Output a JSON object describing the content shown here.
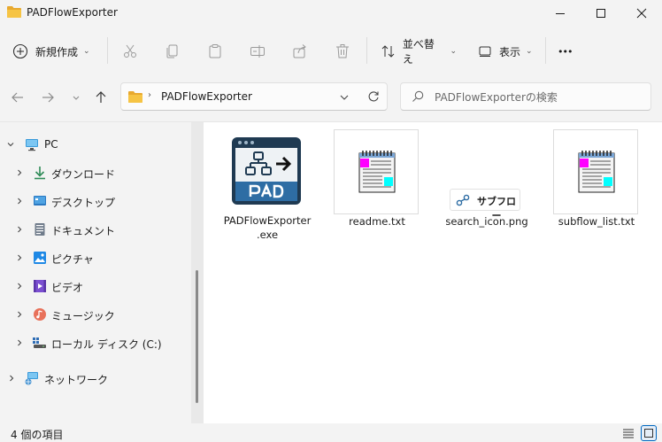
{
  "window": {
    "title": "PADFlowExporter",
    "controls": [
      "minimize",
      "maximize",
      "close"
    ]
  },
  "commandbar": {
    "new_label": "新規作成",
    "sort_label": "並べ替え",
    "view_label": "表示",
    "more_label": "•••"
  },
  "address": {
    "path": "PADFlowExporter"
  },
  "search": {
    "placeholder": "PADFlowExporterの検索"
  },
  "sidebar": {
    "items": [
      {
        "label": "PC",
        "icon": "pc-icon"
      },
      {
        "label": "ダウンロード",
        "icon": "download-icon"
      },
      {
        "label": "デスクトップ",
        "icon": "desktop-icon"
      },
      {
        "label": "ドキュメント",
        "icon": "documents-icon"
      },
      {
        "label": "ピクチャ",
        "icon": "pictures-icon"
      },
      {
        "label": "ビデオ",
        "icon": "videos-icon"
      },
      {
        "label": "ミュージック",
        "icon": "music-icon"
      },
      {
        "label": "ローカル ディスク (C:)",
        "icon": "drive-icon"
      },
      {
        "label": "ネットワーク",
        "icon": "network-icon"
      }
    ]
  },
  "files": [
    {
      "name": "PADFlowExporter\n.exe",
      "line1": "PADFlowExporter",
      "line2": ".exe",
      "icon": "pad-app-icon"
    },
    {
      "name": "readme.txt",
      "icon": "notepad-icon"
    },
    {
      "name": "search_icon.png",
      "icon": "image-thumbnail",
      "thumb_text": "サブフロー"
    },
    {
      "name": "subflow_list.txt",
      "icon": "notepad-icon"
    }
  ],
  "status": {
    "count_text": "4 個の項目"
  },
  "colors": {
    "accent": "#0067c0",
    "pad_blue": "#2e6da4",
    "pad_dark": "#1f3a52"
  }
}
